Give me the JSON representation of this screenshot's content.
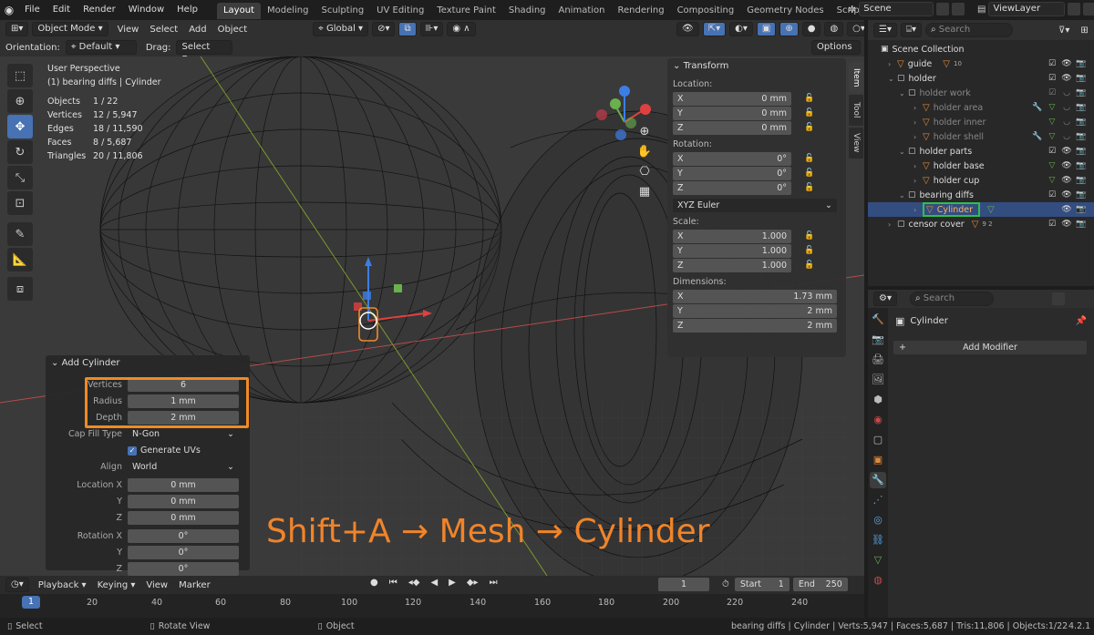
{
  "menu": [
    "File",
    "Edit",
    "Render",
    "Window",
    "Help"
  ],
  "workspaces": [
    "Layout",
    "Modeling",
    "Sculpting",
    "UV Editing",
    "Texture Paint",
    "Shading",
    "Animation",
    "Rendering",
    "Compositing",
    "Geometry Nodes",
    "Scripting"
  ],
  "add_workspace": "+",
  "scene": "Scene",
  "view_layer": "ViewLayer",
  "viewport": {
    "mode": "Object Mode",
    "menus": [
      "View",
      "Select",
      "Add",
      "Object"
    ],
    "transform_orientation": "Global",
    "orientation_label": "Orientation:",
    "orientation_value": "Default",
    "drag_label": "Drag:",
    "drag_value": "Select Box",
    "options_label": "Options",
    "perspective": "User Perspective",
    "active_object": "(1) bearing diffs | Cylinder",
    "stats": [
      {
        "k": "Objects",
        "v": "1 / 22"
      },
      {
        "k": "Vertices",
        "v": "12 / 5,947"
      },
      {
        "k": "Edges",
        "v": "18 / 11,590"
      },
      {
        "k": "Faces",
        "v": "8 / 5,687"
      },
      {
        "k": "Triangles",
        "v": "20 / 11,806"
      }
    ]
  },
  "npanel": {
    "title": "Transform",
    "location_label": "Location:",
    "location": [
      {
        "a": "X",
        "v": "0 mm"
      },
      {
        "a": "Y",
        "v": "0 mm"
      },
      {
        "a": "Z",
        "v": "0 mm"
      }
    ],
    "rotation_label": "Rotation:",
    "rotation": [
      {
        "a": "X",
        "v": "0°"
      },
      {
        "a": "Y",
        "v": "0°"
      },
      {
        "a": "Z",
        "v": "0°"
      }
    ],
    "rotation_mode": "XYZ Euler",
    "scale_label": "Scale:",
    "scale": [
      {
        "a": "X",
        "v": "1.000"
      },
      {
        "a": "Y",
        "v": "1.000"
      },
      {
        "a": "Z",
        "v": "1.000"
      }
    ],
    "dimensions_label": "Dimensions:",
    "dimensions": [
      {
        "a": "X",
        "v": "1.73 mm"
      },
      {
        "a": "Y",
        "v": "2 mm"
      },
      {
        "a": "Z",
        "v": "2 mm"
      }
    ],
    "tabs": [
      "Item",
      "Tool",
      "View"
    ]
  },
  "operator": {
    "title": "Add Cylinder",
    "vertices_label": "Vertices",
    "vertices": "6",
    "radius_label": "Radius",
    "radius": "1 mm",
    "depth_label": "Depth",
    "depth": "2 mm",
    "cap_label": "Cap Fill Type",
    "cap": "N-Gon",
    "uv_label": "Generate UVs",
    "align_label": "Align",
    "align": "World",
    "loc_label": "Location X",
    "loc_x": "0 mm",
    "y_label": "Y",
    "loc_y": "0 mm",
    "z_label": "Z",
    "loc_z": "0 mm",
    "rot_label": "Rotation X",
    "rot_x": "0°",
    "rot_y": "0°",
    "rot_z": "0°"
  },
  "shortcut_caption": "Shift+A → Mesh → Cylinder",
  "timeline": {
    "menus": [
      "Playback",
      "Keying",
      "View",
      "Marker"
    ],
    "current_frame": "1",
    "start_label": "Start",
    "start": "1",
    "end_label": "End",
    "end": "250",
    "ticks": [
      "1",
      "20",
      "40",
      "60",
      "80",
      "100",
      "120",
      "140",
      "160",
      "180",
      "200",
      "220",
      "240"
    ]
  },
  "status": {
    "select": "Select",
    "rotate": "Rotate View",
    "object": "Object",
    "info": "bearing diffs | Cylinder | Verts:5,947 | Faces:5,687 | Tris:11,806 | Objects:1/22",
    "version": "4.2.1"
  },
  "outliner": {
    "search_placeholder": "Search",
    "rows": [
      {
        "label": "Scene Collection",
        "indent": 0,
        "type": "scene"
      },
      {
        "label": "guide",
        "indent": 1,
        "type": "mesh",
        "extra": "10"
      },
      {
        "label": "holder",
        "indent": 1,
        "type": "coll"
      },
      {
        "label": "holder work",
        "indent": 2,
        "type": "coll",
        "dim": true
      },
      {
        "label": "holder area",
        "indent": 3,
        "type": "mesh",
        "dim": true
      },
      {
        "label": "holder inner",
        "indent": 3,
        "type": "mesh",
        "dim": true
      },
      {
        "label": "holder shell",
        "indent": 3,
        "type": "mesh",
        "dim": true
      },
      {
        "label": "holder parts",
        "indent": 2,
        "type": "coll"
      },
      {
        "label": "holder base",
        "indent": 3,
        "type": "mesh"
      },
      {
        "label": "holder cup",
        "indent": 3,
        "type": "mesh"
      },
      {
        "label": "bearing diffs",
        "indent": 2,
        "type": "coll"
      },
      {
        "label": "Cylinder",
        "indent": 3,
        "type": "mesh",
        "selected": true
      },
      {
        "label": "censor cover",
        "indent": 1,
        "type": "coll",
        "extra": "9  2"
      }
    ]
  },
  "properties": {
    "search_placeholder": "Search",
    "object": "Cylinder",
    "add_modifier": "Add Modifier"
  }
}
